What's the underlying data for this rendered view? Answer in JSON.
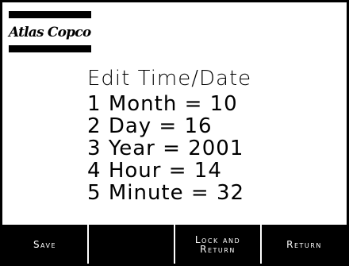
{
  "logo": {
    "text": "Atlas Copco"
  },
  "screen": {
    "title": "Edit Time/Date",
    "items": [
      {
        "number": "1",
        "label": "Month",
        "equals": "=",
        "value": "10"
      },
      {
        "number": "2",
        "label": "Day",
        "equals": "=",
        "value": "16"
      },
      {
        "number": "3",
        "label": "Year",
        "equals": "=",
        "value": "2001"
      },
      {
        "number": "4",
        "label": "Hour",
        "equals": "=",
        "value": "14"
      },
      {
        "number": "5",
        "label": "Minute",
        "equals": "=",
        "value": "32"
      }
    ]
  },
  "softkeys": {
    "save": "Save",
    "blank": "",
    "lock_and_return_line1": "Lock and",
    "lock_and_return_line2": "Return",
    "return": "Return"
  },
  "colors": {
    "foreground": "#000000",
    "background": "#ffffff"
  }
}
